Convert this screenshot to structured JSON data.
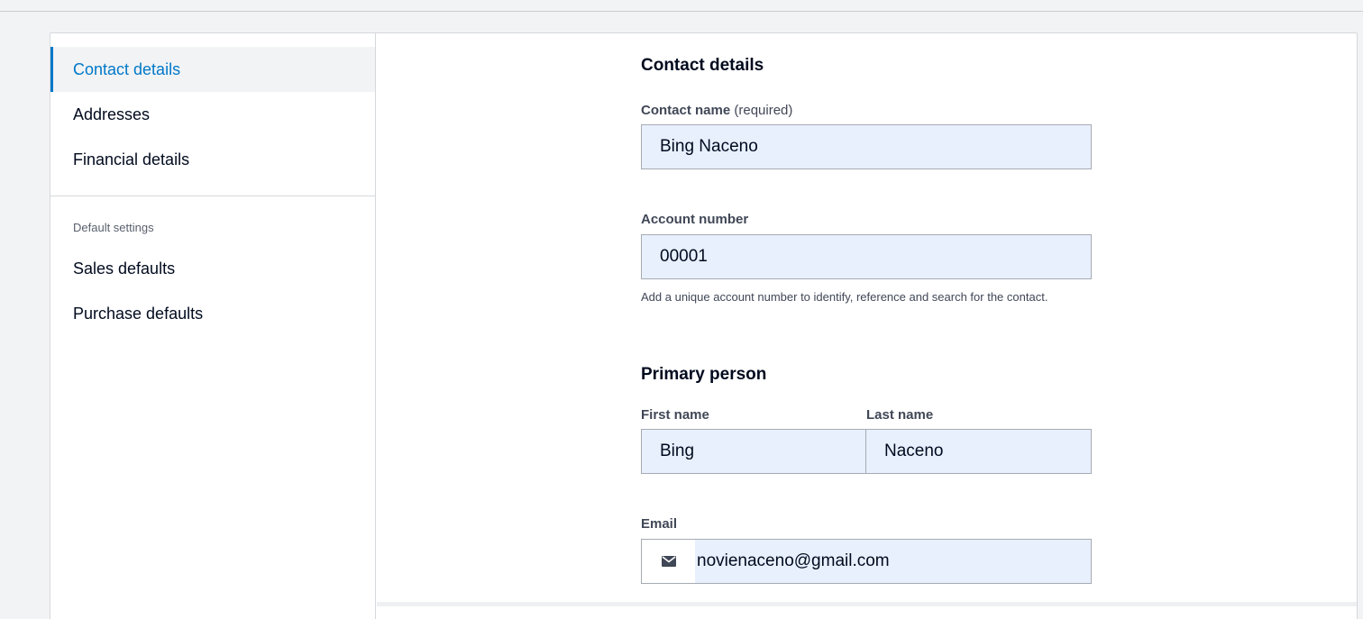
{
  "sidebar": {
    "items": [
      {
        "label": "Contact details",
        "active": true
      },
      {
        "label": "Addresses"
      },
      {
        "label": "Financial details"
      }
    ],
    "section_label": "Default settings",
    "defaults": [
      {
        "label": "Sales defaults"
      },
      {
        "label": "Purchase defaults"
      }
    ]
  },
  "form": {
    "heading": "Contact details",
    "contact_name": {
      "label": "Contact name",
      "hint": "(required)",
      "value": "Bing Naceno"
    },
    "account_number": {
      "label": "Account number",
      "value": "00001",
      "helper": "Add a unique account number to identify, reference and search for the contact."
    },
    "primary_person": {
      "heading": "Primary person",
      "first_name": {
        "label": "First name",
        "value": "Bing"
      },
      "last_name": {
        "label": "Last name",
        "value": "Naceno"
      },
      "email": {
        "label": "Email",
        "value": "novienaceno@gmail.com",
        "icon": "envelope-icon"
      }
    }
  },
  "colors": {
    "accent": "#0078c8",
    "autofill_bg": "#e8f0fe"
  }
}
